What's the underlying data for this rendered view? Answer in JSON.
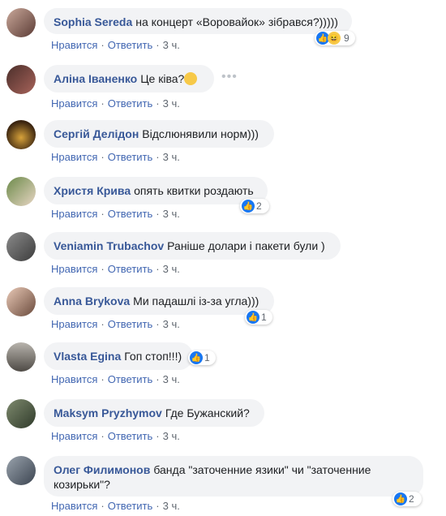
{
  "actions": {
    "like": "Нравится",
    "reply": "Ответить",
    "time": "3 ч."
  },
  "comments": [
    {
      "author": "Sophia Sereda",
      "text": "на концерт «Воровайок» зібрався?)))))",
      "reaction_count": "9"
    },
    {
      "author": "Аліна Іваненко",
      "text": "Це ківа?",
      "reaction_count": ""
    },
    {
      "author": "Сергій Делідон",
      "text": "Відслюнявили норм)))",
      "reaction_count": ""
    },
    {
      "author": "Христя Крива",
      "text": "опять квитки роздають",
      "reaction_count": "2"
    },
    {
      "author": "Veniamin Trubachov",
      "text": "Раніше долари і пакети були )",
      "reaction_count": ""
    },
    {
      "author": "Anna Brykova",
      "text": "Ми падашлі із-за угла)))",
      "reaction_count": "1"
    },
    {
      "author": "Vlasta Egina",
      "text": "Гоп стоп!!!)",
      "reaction_count": "1"
    },
    {
      "author": "Maksym Pryzhymov",
      "text": "Где Бужанский?",
      "reaction_count": ""
    },
    {
      "author": "Олег Филимонов",
      "text": "банда \"заточенние язики\" чи \"заточенние козирьки\"?",
      "reaction_count": "2"
    }
  ],
  "colors": {
    "link": "#385898",
    "like_blue": "#1877f2",
    "bubble_bg": "#f2f3f5"
  }
}
